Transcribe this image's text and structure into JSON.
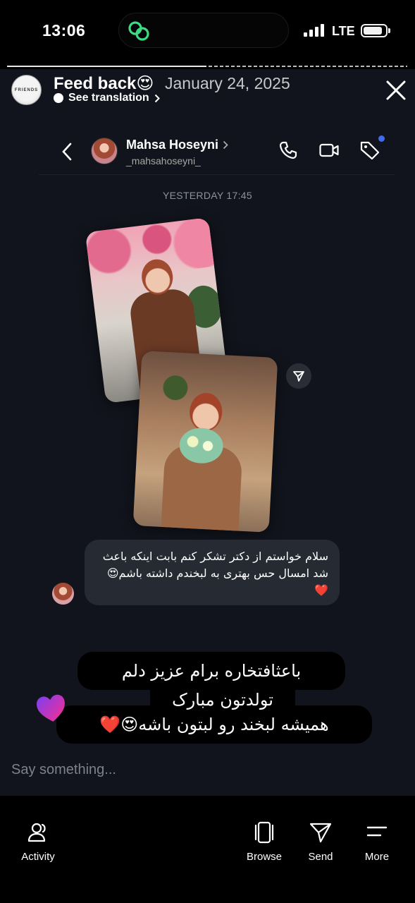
{
  "status_bar": {
    "time": "13:06",
    "network": "LTE",
    "battery_level": 0.9,
    "signal_bars": 4
  },
  "story": {
    "progress_segments": 2,
    "progress_current": 1,
    "title": "Feed back😍",
    "date": "January 24, 2025",
    "translate_label": "See translation",
    "avatar_text": "FRIENDS"
  },
  "dm": {
    "name": "Mahsa Hoseyni",
    "handle": "_mahsahoseyni_",
    "timestamp": "YESTERDAY 17:45",
    "message": "سلام خواستم از دکتر تشکر کنم بابت اینکه باعث شد امسال حس بهتری به لبخندم داشته باشم😍❤️"
  },
  "stickers": {
    "line1": "باعثافتخاره برام عزیز دلم",
    "line2": "تولدتون مبارک",
    "line3": "همیشه لبخند رو لبتون باشه😍❤️"
  },
  "input": {
    "placeholder": "Say something..."
  },
  "bottom_nav": {
    "activity": "Activity",
    "browse": "Browse",
    "send": "Send",
    "more": "More"
  },
  "colors": {
    "background": "#11141c",
    "bubble": "#262a33",
    "accent_dot": "#3e6cf0",
    "link_icon": "#3ddc84"
  }
}
